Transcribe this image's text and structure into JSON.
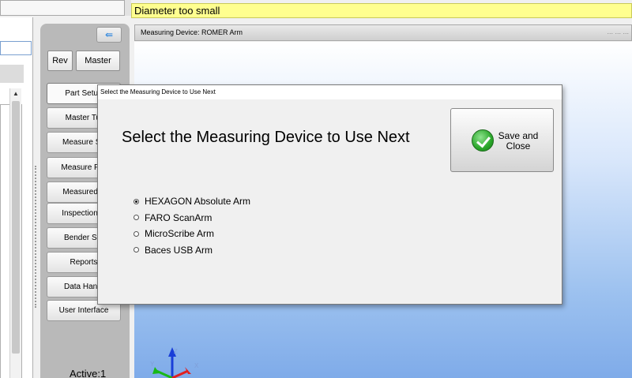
{
  "status_banner": "Diameter too small",
  "device_bar": {
    "label": "Measuring Device: ROMER Arm",
    "dots": "... ... ..."
  },
  "nav": {
    "back_arrow": "⇚",
    "rev": "Rev",
    "master": "Master",
    "items": [
      "Part Setup",
      "Master Tul",
      "Measure Se",
      "Measure Pro",
      "Measured T",
      "Inspection D",
      "Bender Set",
      "Reports",
      "Data Handl",
      "User Interface"
    ],
    "active": "Active:1"
  },
  "dialog": {
    "title": "Select the Measuring Device to Use Next",
    "heading": "Select the Measuring Device to Use Next",
    "save_label": "Save and Close",
    "options": [
      {
        "label": "HEXAGON Absolute Arm",
        "checked": true
      },
      {
        "label": "FARO ScanArm",
        "checked": false
      },
      {
        "label": "MicroScribe Arm",
        "checked": false
      },
      {
        "label": "Baces USB Arm",
        "checked": false
      }
    ]
  },
  "axes": {
    "x": "X",
    "y": "Y",
    "z": "Z"
  },
  "colors": {
    "banner": "#ffff8f",
    "nav_bg": "#b9b9b9",
    "viewport_bottom": "#7fabe9"
  }
}
